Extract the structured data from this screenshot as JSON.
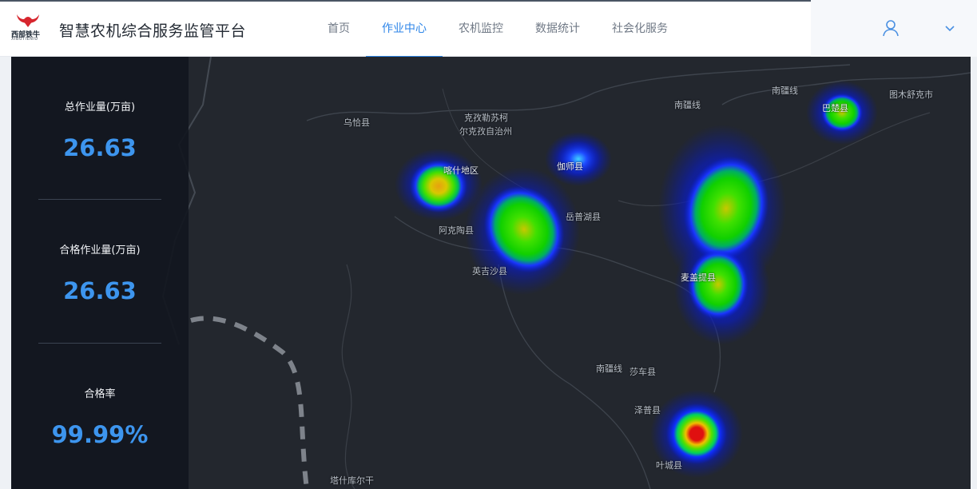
{
  "header": {
    "logo_text": "西部铁牛",
    "logo_sub": "XIBUTIENIU",
    "title": "智慧农机综合服务监管平台",
    "nav": [
      {
        "label": "首页",
        "active": false
      },
      {
        "label": "作业中心",
        "active": true
      },
      {
        "label": "农机监控",
        "active": false
      },
      {
        "label": "数据统计",
        "active": false
      },
      {
        "label": "社会化服务",
        "active": false
      }
    ],
    "user_icon": "user-icon",
    "dropdown_icon": "chevron-down-icon"
  },
  "stats": [
    {
      "label": "总作业量(万亩)",
      "value": "26.63"
    },
    {
      "label": "合格作业量(万亩)",
      "value": "26.63"
    },
    {
      "label": "合格率",
      "value": "99.99%"
    }
  ],
  "map": {
    "labels": {
      "wuqia": "乌恰县",
      "kezhou1": "克孜勒苏柯",
      "kezhou2": "尔克孜自治州",
      "kashi": "喀什地区",
      "jiashi": "伽师县",
      "akto": "阿克陶县",
      "yuepuhu": "岳普湖县",
      "yingjisha": "英吉沙县",
      "maigaiti": "麦盖提县",
      "nanjiang1": "南疆线",
      "nanjiang2": "南疆线",
      "nanjiang3": "南疆线",
      "tumxuk": "图木舒克市",
      "bachu": "巴楚县",
      "shache": "莎车县",
      "zepu": "泽普县",
      "yecheng": "叶城县",
      "taxkorgan": "塔什库尔干"
    }
  },
  "colors": {
    "accent": "#2f86e8",
    "stat_value": "#3d95ee",
    "map_bg": "#23272e",
    "panel_bg": "#12171f"
  }
}
